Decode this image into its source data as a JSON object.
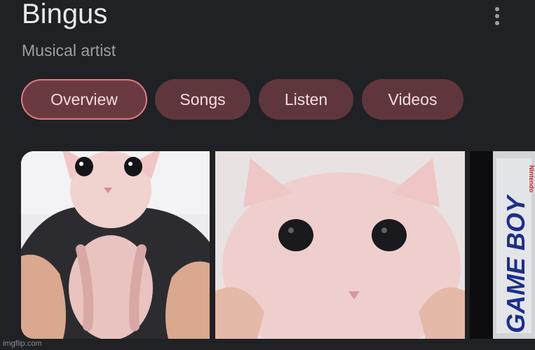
{
  "knowledge_panel": {
    "title": "Bingus",
    "subtitle": "Musical artist",
    "more_icon": "more-vert-icon"
  },
  "tabs": [
    {
      "label": "Overview",
      "active": true
    },
    {
      "label": "Songs",
      "active": false
    },
    {
      "label": "Listen",
      "active": false
    },
    {
      "label": "Videos",
      "active": false
    }
  ],
  "images": {
    "third_image_text": "GAME BOY",
    "third_image_brand": "Nintendo"
  },
  "watermark": "imgflip.com",
  "colors": {
    "background": "#202124",
    "chip_background": "#5f363c",
    "chip_active_border": "#e07a86"
  }
}
